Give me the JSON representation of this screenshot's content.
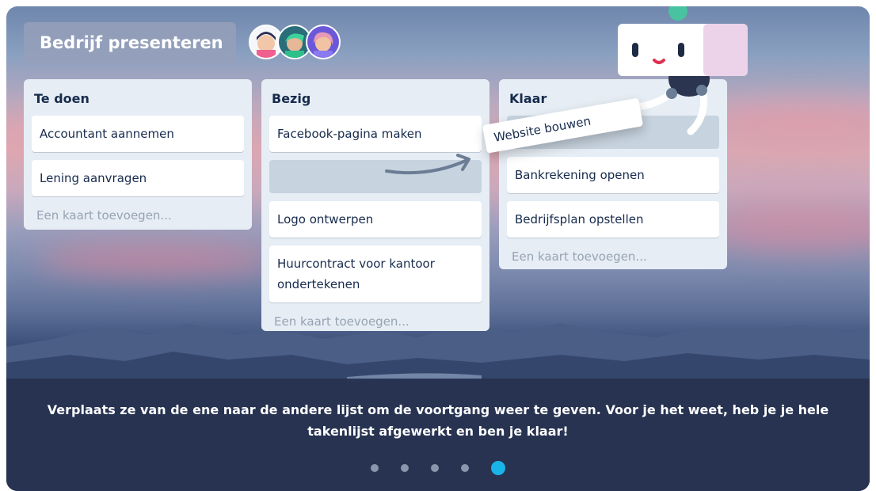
{
  "board": {
    "title": "Bedrijf presenteren",
    "members": [
      {
        "name": "member-1",
        "bg": "#f5f7fb",
        "hair": "#2d2f55"
      },
      {
        "name": "member-2",
        "bg": "#2a6e7a",
        "hair": "#3fd19b"
      },
      {
        "name": "member-3",
        "bg": "#6a58d8",
        "hair": "#e79ab6"
      }
    ]
  },
  "lists": [
    {
      "title": "Te doen",
      "cards": [
        "Accountant aannemen",
        "Lening aanvragen"
      ],
      "add_label": "Een kaart toevoegen..."
    },
    {
      "title": "Bezig",
      "cards": [
        "Facebook-pagina maken",
        "Logo ontwerpen",
        "Huurcontract voor kantoor ondertekenen"
      ],
      "add_label": "Een kaart toevoegen..."
    },
    {
      "title": "Klaar",
      "cards": [
        "Bankrekening openen",
        "Bedrijfsplan opstellen"
      ],
      "add_label": "Een kaart toevoegen..."
    }
  ],
  "dragging_card": "Website bouwen",
  "caption": "Verplaats ze van de ene naar de andere lijst om de voortgang weer te geven. Voor je het weet, heb je je hele takenlijst afgewerkt en ben je klaar!",
  "pagination": {
    "total": 5,
    "active": 5
  },
  "colors": {
    "accent": "#19b4e8",
    "list_bg": "#e6edf4",
    "text": "#172b4d"
  }
}
